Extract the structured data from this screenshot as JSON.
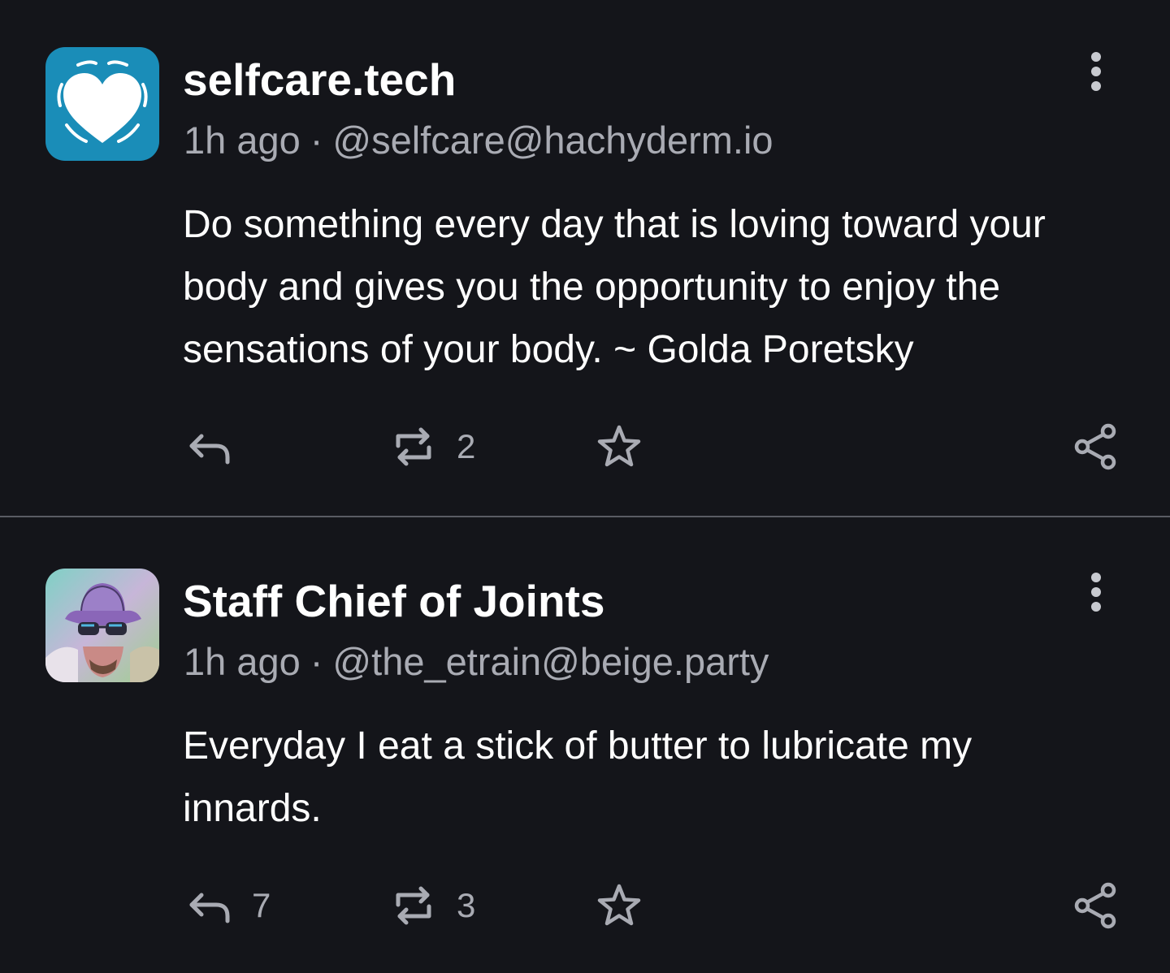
{
  "posts": [
    {
      "display_name": "selfcare.tech",
      "time": "1h ago",
      "separator": "·",
      "handle": "@selfcare@hachyderm.io",
      "content": "Do something every day that is loving toward your body and gives you the opportunity to enjoy the sensations of your body. ~ Golda Poretsky",
      "avatar_icon": "heart-icon",
      "avatar_color": "#1a8db8",
      "reply_count": "",
      "boost_count": "2",
      "favorite_count": ""
    },
    {
      "display_name": "Staff Chief of Joints",
      "time": "1h ago",
      "separator": "·",
      "handle": "@the_etrain@beige.party",
      "content": "Everyday I eat a stick of butter to lubricate my innards.",
      "avatar_icon": "user-photo",
      "reply_count": "7",
      "boost_count": "3",
      "favorite_count": ""
    }
  ],
  "colors": {
    "background": "#14151a",
    "text": "#ffffff",
    "muted": "#a9abb3",
    "divider": "#5a5c63"
  },
  "icons": {
    "reply": "reply-icon",
    "boost": "boost-icon",
    "favorite": "star-icon",
    "share": "share-icon",
    "more": "more-vertical-icon"
  }
}
